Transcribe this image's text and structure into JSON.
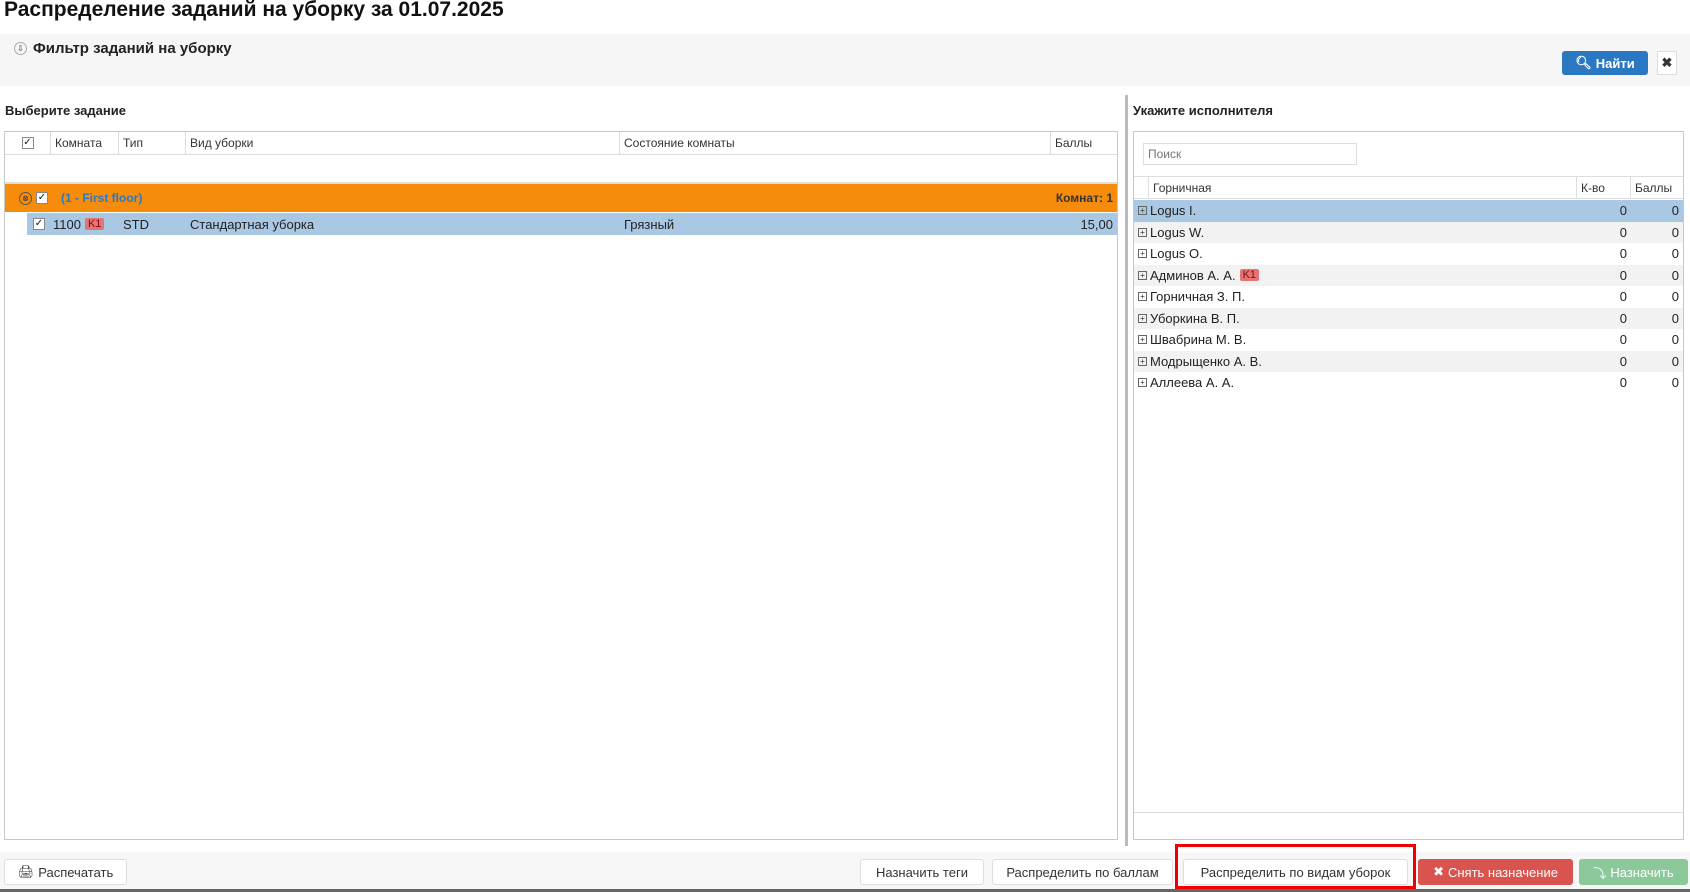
{
  "title": "Распределение заданий на уборку за 01.07.2025",
  "filter": {
    "title": "Фильтр заданий на уборку",
    "find_label": "Найти",
    "clear_icon": "close-icon"
  },
  "tasks": {
    "title": "Выберите задание",
    "columns": [
      "Комната",
      "Тип",
      "Вид уборки",
      "Состояние комнаты",
      "Баллы"
    ],
    "group": {
      "label": "(1 - First floor)",
      "summary": "Комнат: 1"
    },
    "rows": [
      {
        "room": "1100",
        "tag": "K1",
        "type": "STD",
        "kind": "Стандартная уборка",
        "state": "Грязный",
        "points": "15,00"
      }
    ]
  },
  "maids": {
    "title": "Укажите исполнителя",
    "search_placeholder": "Поиск",
    "columns": [
      "Горничная",
      "К-во",
      "Баллы"
    ],
    "rows": [
      {
        "name": "Logus I.",
        "tag": "",
        "count": "0",
        "points": "0"
      },
      {
        "name": "Logus W.",
        "tag": "",
        "count": "0",
        "points": "0"
      },
      {
        "name": "Logus O.",
        "tag": "",
        "count": "0",
        "points": "0"
      },
      {
        "name": "Админов А. А.",
        "tag": "K1",
        "count": "0",
        "points": "0"
      },
      {
        "name": "Горничная З. П.",
        "tag": "",
        "count": "0",
        "points": "0"
      },
      {
        "name": "Уборкина В. П.",
        "tag": "",
        "count": "0",
        "points": "0"
      },
      {
        "name": "Швабрина М. В.",
        "tag": "",
        "count": "0",
        "points": "0"
      },
      {
        "name": "Модрыщенко А. В.",
        "tag": "",
        "count": "0",
        "points": "0"
      },
      {
        "name": "Аллеева А. А.",
        "tag": "",
        "count": "0",
        "points": "0"
      }
    ]
  },
  "footer": {
    "print": "Распечатать",
    "tags": "Назначить теги",
    "by_points": "Распределить по баллам",
    "by_kinds": "Распределить по видам уборок",
    "unassign": "Снять назначение",
    "assign": "Назначить"
  },
  "colors": {
    "group": "#f68c0c",
    "selected": "#a9c8e4",
    "primary": "#2b78c2",
    "danger": "#d9534f",
    "success": "#8cc99a",
    "highlight": "#ee0000"
  }
}
